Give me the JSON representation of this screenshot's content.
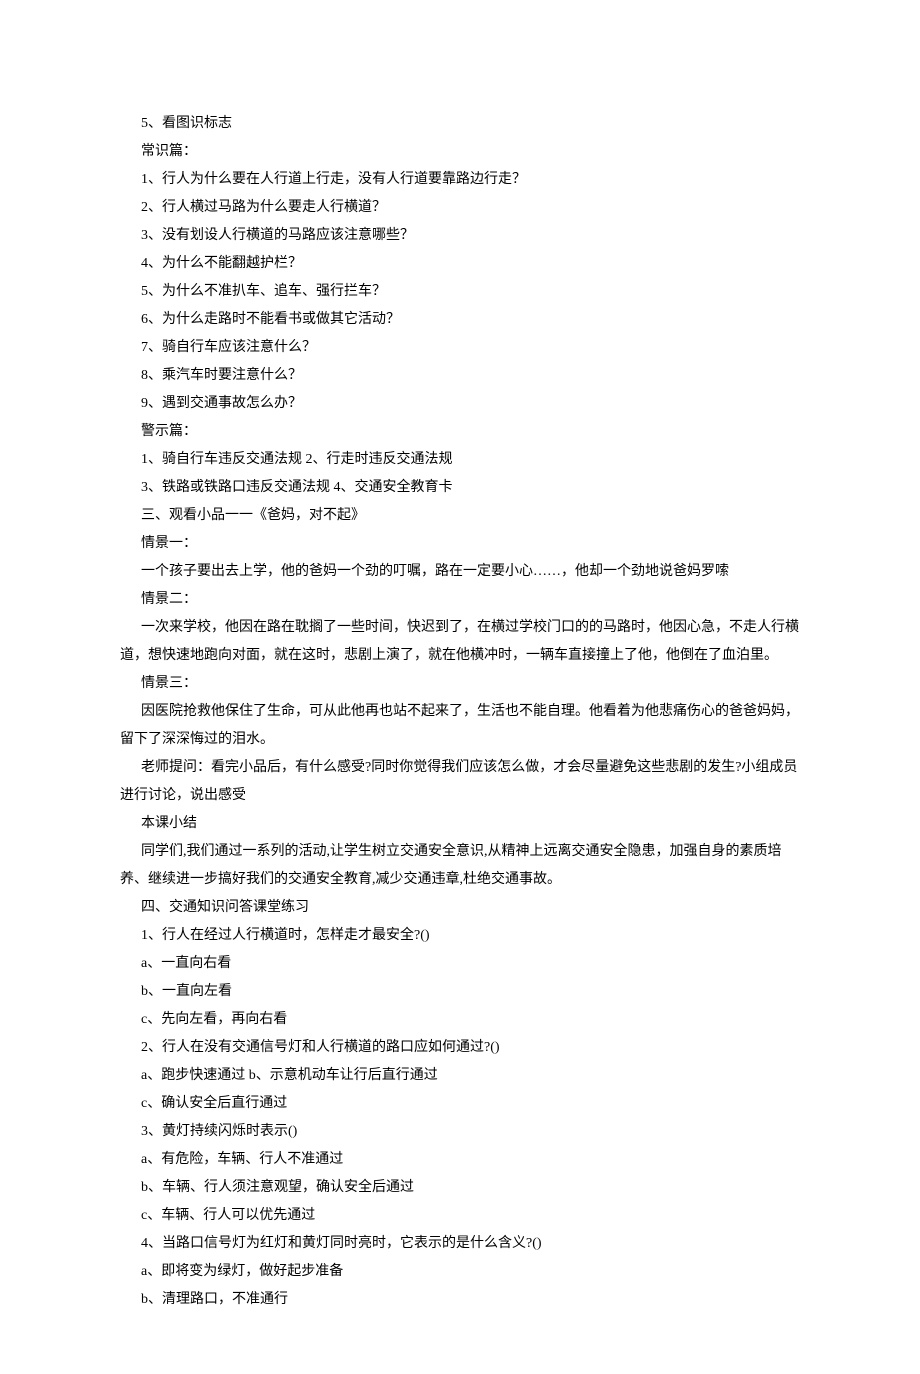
{
  "lines": [
    "5、看图识标志",
    "常识篇：",
    "1、行人为什么要在人行道上行走，没有人行道要靠路边行走？",
    "2、行人横过马路为什么要走人行横道？",
    "3、没有划设人行横道的马路应该注意哪些？",
    "4、为什么不能翻越护栏？",
    "5、为什么不准扒车、追车、强行拦车？",
    "6、为什么走路时不能看书或做其它活动？",
    "7、骑自行车应该注意什么？",
    "8、乘汽车时要注意什么？",
    "9、遇到交通事故怎么办？",
    "警示篇：",
    "1、骑自行车违反交通法规 2、行走时违反交通法规",
    "3、铁路或铁路口违反交通法规 4、交通安全教育卡",
    "三、观看小品一一《爸妈，对不起》",
    "情景一：",
    "一个孩子要出去上学，他的爸妈一个劲的叮嘱，路在一定要小心……，他却一个劲地说爸妈罗嗦",
    "情景二：",
    "一次来学校，他因在路在耽搁了一些时间，快迟到了，在横过学校门口的的马路时，他因心急，不走人行横道，想快速地跑向对面，就在这时，悲剧上演了，就在他横冲时，一辆车直接撞上了他，他倒在了血泊里。",
    "情景三：",
    "因医院抢救他保住了生命，可从此他再也站不起来了，生活也不能自理。他看着为他悲痛伤心的爸爸妈妈，留下了深深悔过的泪水。",
    "老师提问：看完小品后，有什么感受?同时你觉得我们应该怎么做，才会尽量避免这些悲剧的发生?小组成员进行讨论，说出感受",
    "本课小结",
    "同学们,我们通过一系列的活动,让学生树立交通安全意识,从精神上远离交通安全隐患，加强自身的素质培养、继续进一步搞好我们的交通安全教育,减少交通违章,杜绝交通事故。",
    "四、交通知识问答课堂练习",
    "1、行人在经过人行横道时，怎样走才最安全?()",
    "a、一直向右看",
    "b、一直向左看",
    "c、先向左看，再向右看",
    "2、行人在没有交通信号灯和人行横道的路口应如何通过?()",
    "a、跑步快速通过 b、示意机动车让行后直行通过",
    "c、确认安全后直行通过",
    "3、黄灯持续闪烁时表示()",
    "a、有危险，车辆、行人不准通过",
    "b、车辆、行人须注意观望，确认安全后通过",
    "c、车辆、行人可以优先通过",
    "4、当路口信号灯为红灯和黄灯同时亮时，它表示的是什么含义?()",
    "a、即将变为绿灯，做好起步准备",
    "b、清理路口，不准通行"
  ],
  "wrapIndices": [
    18,
    20,
    21,
    23
  ]
}
